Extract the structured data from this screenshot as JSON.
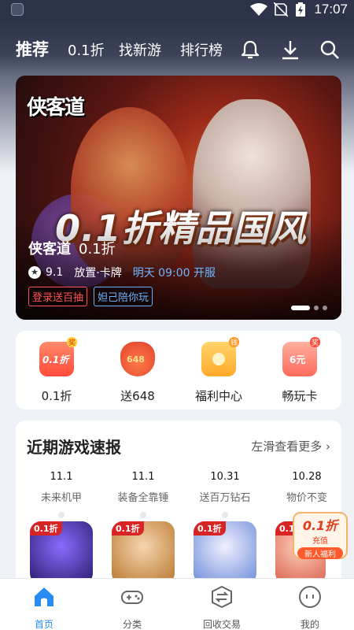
{
  "statusbar": {
    "time": "17:07"
  },
  "topnav": {
    "tabs": [
      {
        "label": "推荐",
        "active": true
      },
      {
        "label": "0.1折",
        "active": false
      },
      {
        "label": "找新游",
        "active": false
      },
      {
        "label": "排行榜",
        "active": false
      }
    ],
    "icons": [
      "bell-icon",
      "download-icon",
      "search-icon"
    ]
  },
  "banner": {
    "logo_text": "侠客道",
    "slogan": "0.1折精品国风",
    "game_name": "侠客道",
    "discount": "0.1折",
    "rating": "9.1",
    "genre": "放置·卡牌",
    "release": "明天 09:00 开服",
    "tags": [
      "登录送百抽",
      "妲己陪你玩"
    ],
    "slide_count": 3,
    "active_slide": 0
  },
  "quick_entries": [
    {
      "label": "0.1折",
      "icon": "discount-coupon-icon",
      "icon_text": "0.1折",
      "corner": "奖",
      "color": "#ff5a45"
    },
    {
      "label": "送648",
      "icon": "lucky-bag-icon",
      "icon_text": "648",
      "color": "#f05a3a"
    },
    {
      "label": "福利中心",
      "icon": "gift-box-icon",
      "icon_text": "",
      "corner": "钱",
      "color": "#ffb23a"
    },
    {
      "label": "畅玩卡",
      "icon": "vip-card-icon",
      "icon_text": "6元",
      "corner": "奖",
      "color": "#ff7a6a"
    }
  ],
  "news": {
    "title": "近期游戏速报",
    "more": "左滑查看更多",
    "items": [
      {
        "date": "11.1",
        "name": "未来机甲",
        "badge": "0.1折"
      },
      {
        "date": "11.1",
        "name": "装备全靠锤",
        "badge": "0.1折"
      },
      {
        "date": "10.31",
        "name": "送百万钻石",
        "badge": "0.1折"
      },
      {
        "date": "10.28",
        "name": "物价不变",
        "badge": "0.1折"
      }
    ]
  },
  "promo": {
    "title": "0.1折",
    "subtitle": "充值",
    "button": "新人福利"
  },
  "bottomnav": [
    {
      "label": "首页",
      "icon": "home-icon",
      "active": true
    },
    {
      "label": "分类",
      "icon": "gamepad-icon",
      "active": false
    },
    {
      "label": "回收交易",
      "icon": "exchange-icon",
      "active": false
    },
    {
      "label": "我的",
      "icon": "profile-icon",
      "active": false
    }
  ],
  "colors": {
    "accent": "#2a8cf0",
    "header": "#2d3349",
    "red": "#d82424"
  }
}
